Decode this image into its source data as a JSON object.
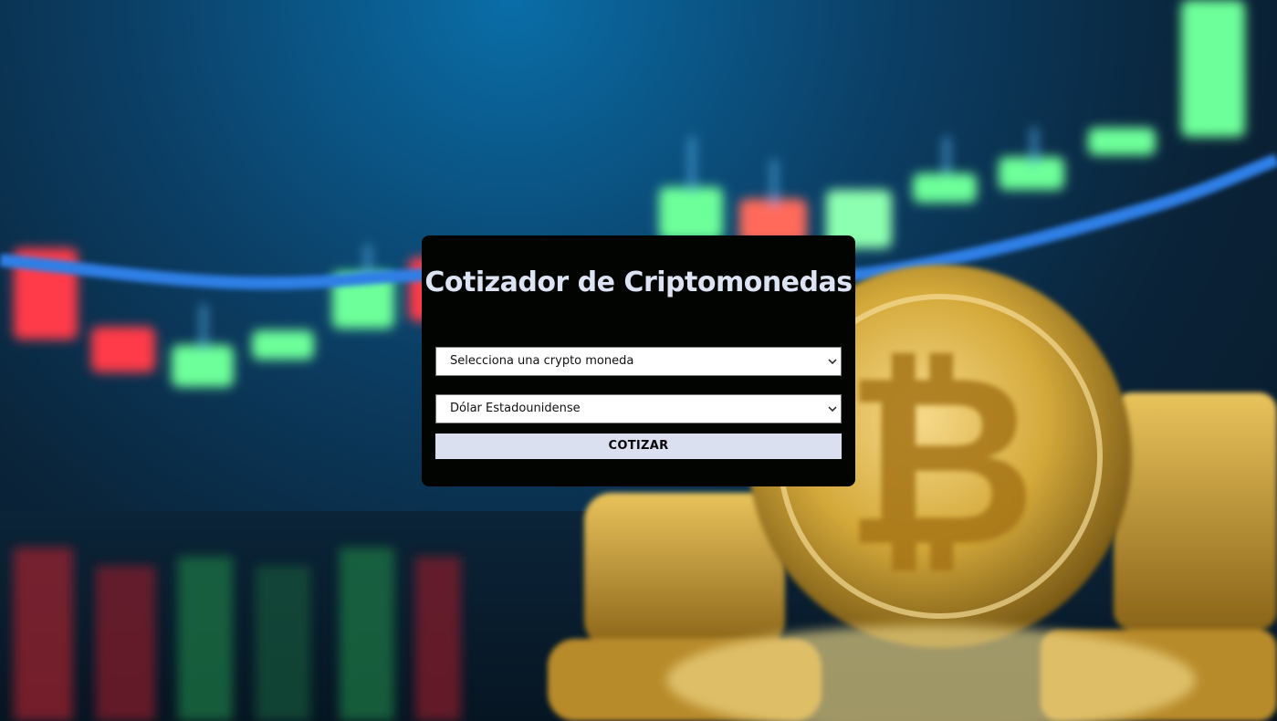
{
  "app": {
    "title": "Cotizador de Criptomonedas"
  },
  "form": {
    "crypto_select": {
      "selected": "Selecciona una crypto moneda"
    },
    "currency_select": {
      "selected": "Dólar Estadounidense"
    },
    "submit_label": "COTIZAR"
  },
  "background": {
    "description_icon": "bitcoin-candlestick-background",
    "colors": {
      "sky": "#0b3f66",
      "candle_red": "#ff3b4a",
      "candle_green": "#6dff9a",
      "trend_line": "#2f7fe6",
      "coin_gold": "#d4a93a"
    }
  },
  "theme": {
    "card_bg": "#020402",
    "title_color": "#dce3f2",
    "button_bg": "#dbe0f0"
  }
}
